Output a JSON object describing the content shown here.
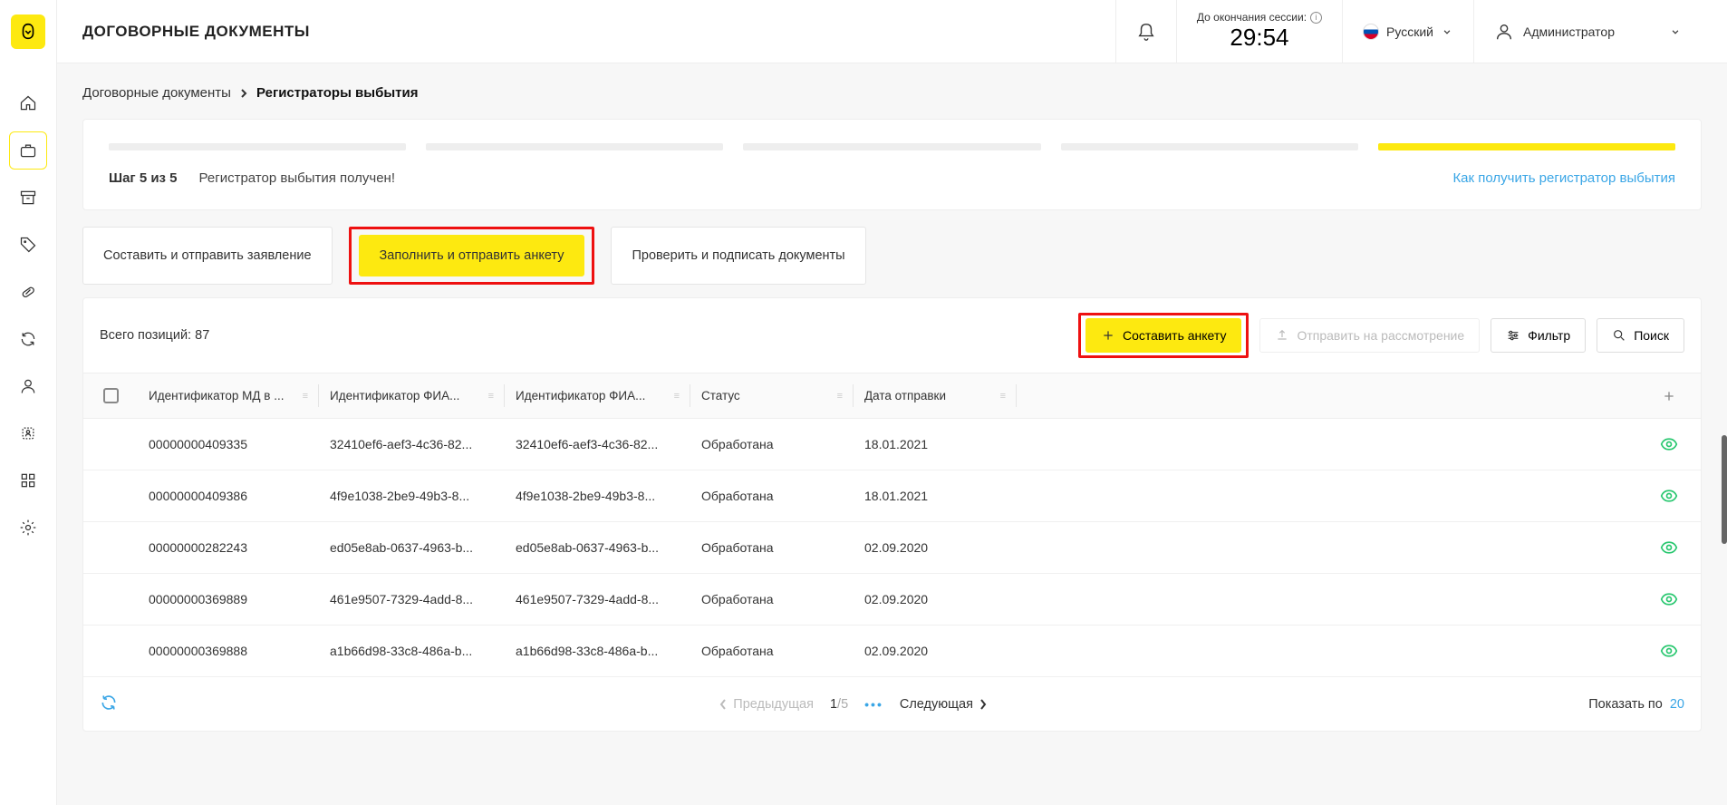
{
  "header": {
    "title": "ДОГОВОРНЫЕ ДОКУМЕНТЫ",
    "session_label": "До окончания сессии:",
    "session_timer": "29:54",
    "lang": "Русский",
    "user_role": "Администратор"
  },
  "breadcrumb": {
    "root": "Договорные документы",
    "current": "Регистраторы выбытия"
  },
  "progress": {
    "step_label": "Шаг 5 из 5",
    "step_text": "Регистратор выбытия получен!",
    "help_link": "Как получить регистратор выбытия"
  },
  "tabs": {
    "compose": "Составить и отправить заявление",
    "fill": "Заполнить и отправить анкету",
    "verify": "Проверить и подписать документы"
  },
  "toolbar": {
    "total_label": "Всего позиций:",
    "total_count": "87",
    "create_btn": "Составить анкету",
    "send_btn": "Отправить на рассмотрение",
    "filter_btn": "Фильтр",
    "search_btn": "Поиск"
  },
  "columns": {
    "md_id": "Идентификатор МД в ...",
    "fias1": "Идентификатор ФИА...",
    "fias2": "Идентификатор ФИА...",
    "status": "Статус",
    "date": "Дата отправки"
  },
  "rows": [
    {
      "md": "00000000409335",
      "fias1": "32410ef6-aef3-4c36-82...",
      "fias2": "32410ef6-aef3-4c36-82...",
      "status": "Обработана",
      "date": "18.01.2021"
    },
    {
      "md": "00000000409386",
      "fias1": "4f9e1038-2be9-49b3-8...",
      "fias2": "4f9e1038-2be9-49b3-8...",
      "status": "Обработана",
      "date": "18.01.2021"
    },
    {
      "md": "00000000282243",
      "fias1": "ed05e8ab-0637-4963-b...",
      "fias2": "ed05e8ab-0637-4963-b...",
      "status": "Обработана",
      "date": "02.09.2020"
    },
    {
      "md": "00000000369889",
      "fias1": "461e9507-7329-4add-8...",
      "fias2": "461e9507-7329-4add-8...",
      "status": "Обработана",
      "date": "02.09.2020"
    },
    {
      "md": "00000000369888",
      "fias1": "a1b66d98-33c8-486a-b...",
      "fias2": "a1b66d98-33c8-486a-b...",
      "status": "Обработана",
      "date": "02.09.2020"
    }
  ],
  "pager": {
    "prev": "Предыдущая",
    "next": "Следующая",
    "page_current": "1",
    "page_sep": "/",
    "page_total": "5",
    "show_label": "Показать по",
    "show_count": "20"
  }
}
